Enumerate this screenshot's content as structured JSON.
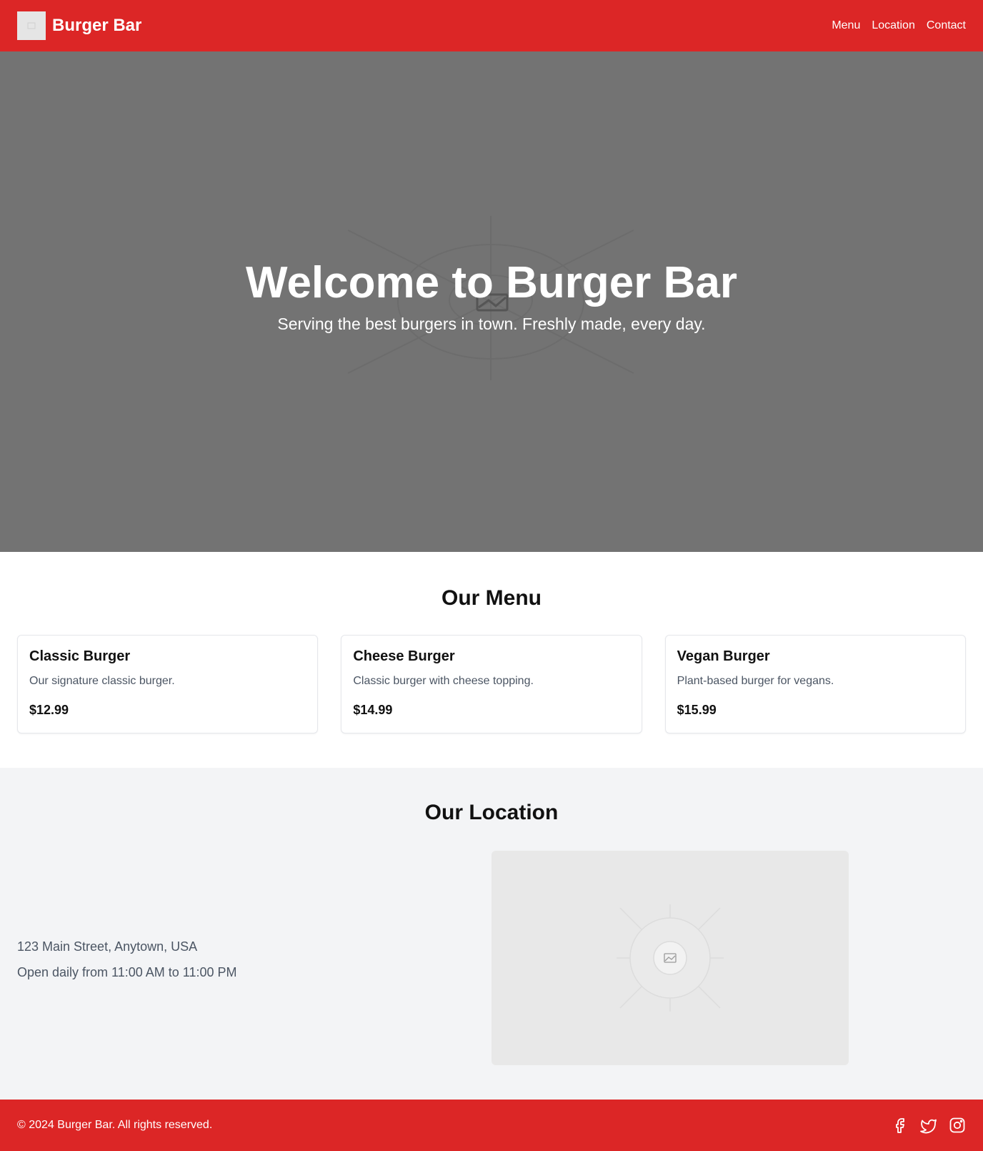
{
  "header": {
    "brand": "Burger Bar",
    "logo_icon": "image-placeholder-icon",
    "nav": [
      {
        "label": "Menu"
      },
      {
        "label": "Location"
      },
      {
        "label": "Contact"
      }
    ]
  },
  "hero": {
    "title": "Welcome to Burger Bar",
    "subtitle": "Serving the best burgers in town. Freshly made, every day.",
    "background_icon": "image-placeholder-icon"
  },
  "menu": {
    "title": "Our Menu",
    "items": [
      {
        "name": "Classic Burger",
        "description": "Our signature classic burger.",
        "price": "$12.99"
      },
      {
        "name": "Cheese Burger",
        "description": "Classic burger with cheese topping.",
        "price": "$14.99"
      },
      {
        "name": "Vegan Burger",
        "description": "Plant-based burger for vegans.",
        "price": "$15.99"
      }
    ]
  },
  "location": {
    "title": "Our Location",
    "address": "123 Main Street, Anytown, USA",
    "hours": "Open daily from 11:00 AM to 11:00 PM",
    "map_icon": "image-placeholder-icon"
  },
  "footer": {
    "copyright": "© 2024 Burger Bar. All rights reserved.",
    "social_icons": [
      "facebook-icon",
      "twitter-icon",
      "instagram-icon"
    ]
  },
  "colors": {
    "brand_red": "#dc2626",
    "hero_gray": "#737373",
    "section_gray": "#f3f4f6"
  }
}
